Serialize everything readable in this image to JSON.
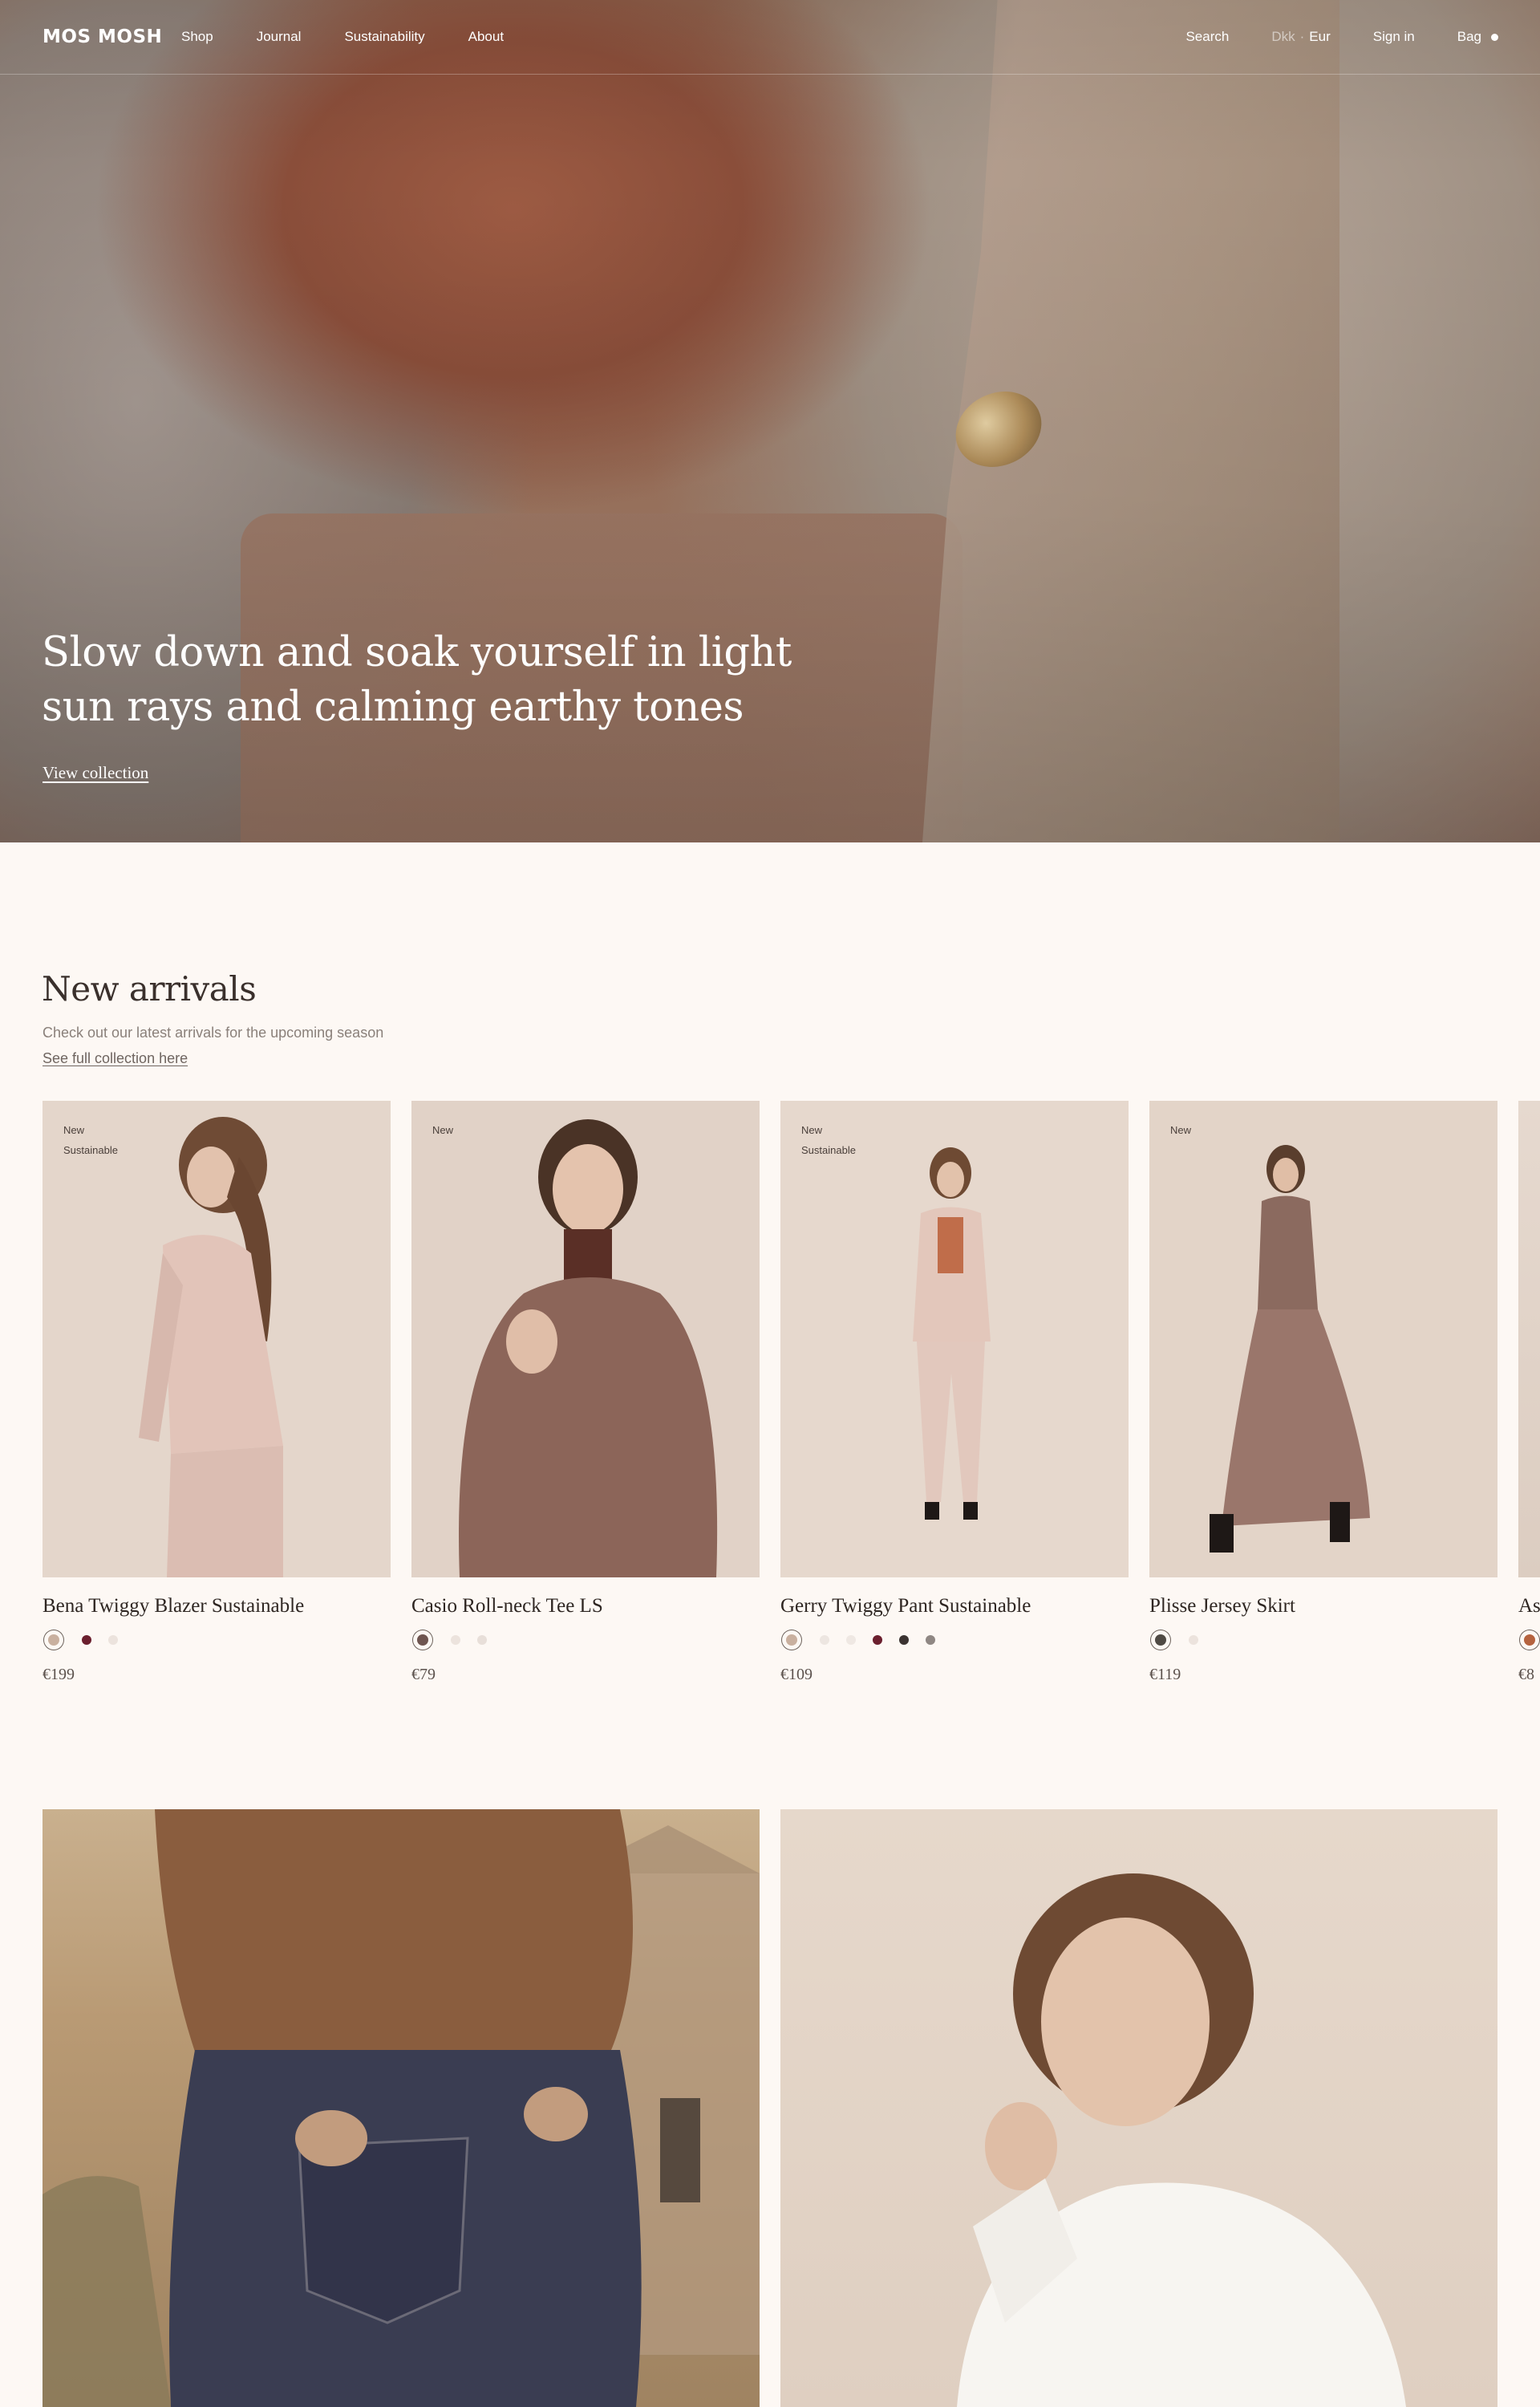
{
  "nav": {
    "logo": "MOS MOSH",
    "links": [
      "Shop",
      "Journal",
      "Sustainability",
      "About"
    ],
    "search": "Search",
    "currency_inactive": "Dkk",
    "currency_separator": "·",
    "currency_active": "Eur",
    "sign_in": "Sign in",
    "bag": "Bag"
  },
  "hero": {
    "title": "Slow down and soak yourself in light sun rays and calming earthy tones",
    "link": "View collection"
  },
  "arrivals": {
    "title": "New arrivals",
    "subtitle": "Check out our latest arrivals for the upcoming season",
    "link": "See full collection here",
    "products": [
      {
        "badges": [
          "New",
          "Sustainable"
        ],
        "name": "Bena Twiggy Blazer Sustainable",
        "price": "€199",
        "swatches": [
          "#c9b09f",
          "#6b1f2e",
          "#ece3dd"
        ]
      },
      {
        "badges": [
          "New"
        ],
        "name": "Casio Roll-neck Tee LS",
        "price": "€79",
        "swatches": [
          "#6e5550",
          "#ece3dd",
          "#e8dfd9"
        ]
      },
      {
        "badges": [
          "New",
          "Sustainable"
        ],
        "name": "Gerry Twiggy Pant Sustainable",
        "price": "€109",
        "swatches": [
          "#c9b09f",
          "#ede6e1",
          "#efe8e3",
          "#6b1f2e",
          "#3b3331",
          "#8f8783"
        ]
      },
      {
        "badges": [
          "New"
        ],
        "name": "Plisse Jersey Skirt",
        "price": "€119",
        "swatches": [
          "#4f4a44",
          "#ece3dd"
        ]
      },
      {
        "badges": [],
        "name": "As",
        "price": "€8",
        "swatches": [
          "#b5633f"
        ]
      }
    ]
  },
  "colors": {
    "background": "#fdf8f4",
    "text": "#2b2320",
    "muted": "#8a807a"
  }
}
